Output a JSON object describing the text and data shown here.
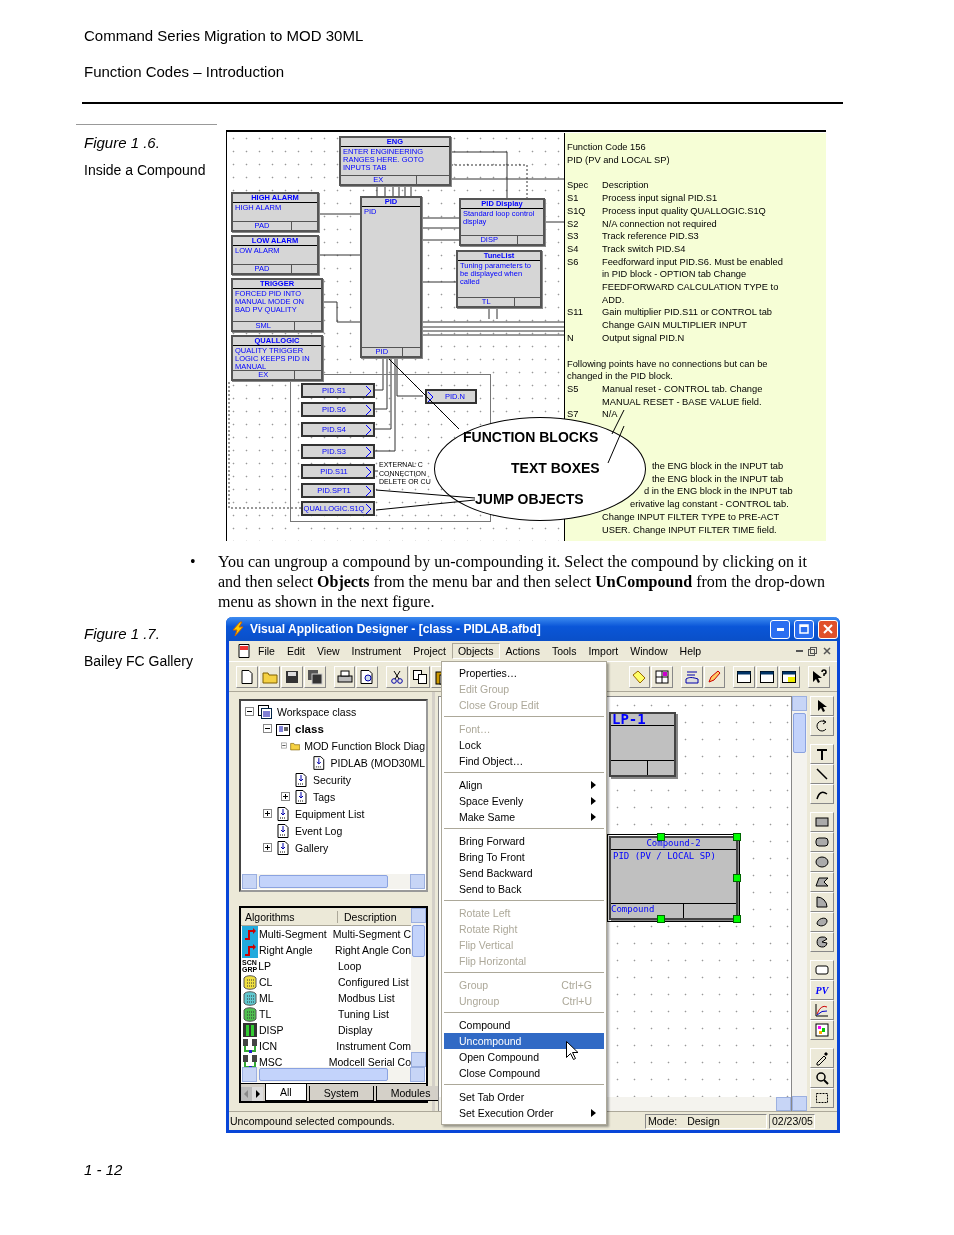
{
  "header": {
    "title": "Command Series Migration to MOD 30ML",
    "section": "Function Codes – Introduction"
  },
  "figure_1": {
    "number": "Figure 1 .6.",
    "caption": "Inside a Compound",
    "blocks": [
      {
        "title": "ENG",
        "text": "ENTER ENGINEERING RANGES HERE. GOTO INPUTS TAB",
        "footer": "EX"
      },
      {
        "title": "HIGH ALARM",
        "text": "HIGH ALARM",
        "footer": "PAD"
      },
      {
        "title": "LOW ALARM",
        "text": "LOW ALARM",
        "footer": "PAD"
      },
      {
        "title": "TRIGGER",
        "text": "FORCED PID INTO MANUAL MODE ON BAD PV QUALITY",
        "footer": "SML"
      },
      {
        "title": "QUALLOGIC",
        "text": "QUALITY TRIGGER LOGIC KEEPS PID IN MANUAL",
        "footer": "EX"
      },
      {
        "title": "PID",
        "text": "PID",
        "footer": "PID"
      },
      {
        "title": "PID Display",
        "text": "Standard loop control display",
        "footer": "DISP"
      },
      {
        "title": "TuneList",
        "text": "Tuning parameters to be displayed when called",
        "footer": "TL"
      }
    ],
    "jumps": [
      "PID.S1",
      "PID.S6",
      "PID.S4",
      "PID.S3",
      "PID.S11",
      "PID.SPT1",
      "QUALLOGIC.S1Q"
    ],
    "output_jump": "PID.N",
    "note": [
      "EXTERNAL C",
      "CONNECTION",
      "DELETE OR CU"
    ],
    "callout": [
      "FUNCTION BLOCKS",
      "TEXT BOXES",
      "JUMP OBJECTS"
    ],
    "panel": {
      "heading": [
        "Function Code 156",
        "PID (PV and LOCAL SP)"
      ],
      "columns": [
        "Spec",
        "Description"
      ],
      "rows": [
        {
          "spec": "S1",
          "desc": "Process input signal PID.S1"
        },
        {
          "spec": "S1Q",
          "desc": "Process input quality QUALLOGIC.S1Q"
        },
        {
          "spec": "S2",
          "desc": "N/A connection not required"
        },
        {
          "spec": "S3",
          "desc": "Track reference PID.S3"
        },
        {
          "spec": "S4",
          "desc": "Track switch PID.S4"
        },
        {
          "spec": "S6",
          "desc": "Feedforward input PID.S6. Must be enabled in PID block - OPTION tab Change FEEDFORWARD CALCULATION TYPE to ADD."
        },
        {
          "spec": "S11",
          "desc": "Gain multiplier PID.S11 or CONTROL tab Change GAIN MULTIPLIER INPUT"
        },
        {
          "spec": "N",
          "desc": "Output signal PID.N"
        }
      ],
      "note": "Following points have no connections but can be changed in the PID block.",
      "rows_2": [
        {
          "spec": "S5",
          "desc": "Manual reset - CONTROL tab. Change MANUAL RESET - BASE VALUE field."
        },
        {
          "spec": "S7",
          "desc": "N/A"
        }
      ],
      "fragments": [
        "the ENG block in the INPUT tab",
        "the ENG block in the INPUT tab",
        "d in the ENG block in the INPUT tab",
        "erivative lag constant - CONTROL tab.",
        "Change INPUT FILTER TYPE to PRE-ACT",
        "USER. Change INPUT FILTER TIME field."
      ]
    }
  },
  "bullet": {
    "mark": "•",
    "text": "You can ungroup a compound by un-compounding it. Select the compound by clicking on it and then select **Objects** from the menu bar and then select **UnCompound** from the drop-down menu as shown in the next figure."
  },
  "figure_2": {
    "number": "Figure 1 .7.",
    "caption": "Bailey FC Gallery",
    "window": {
      "title": "Visual Application Designer - [class - PIDLAB.afbd]",
      "menu": [
        {
          "label": "File",
          "selected": false
        },
        {
          "label": "Edit",
          "selected": false
        },
        {
          "label": "View",
          "selected": false
        },
        {
          "label": "Instrument",
          "selected": false
        },
        {
          "label": "Project",
          "selected": false
        },
        {
          "label": "Objects",
          "selected": true
        },
        {
          "label": "Actions",
          "selected": false
        },
        {
          "label": "Tools",
          "selected": false
        },
        {
          "label": "Import",
          "selected": false
        },
        {
          "label": "Window",
          "selected": false
        },
        {
          "label": "Help",
          "selected": false
        }
      ],
      "tree": [
        {
          "label": "Workspace class",
          "kind": "workspace",
          "expanded": true,
          "active": false,
          "children": [
            {
              "label": "class",
              "kind": "project",
              "expanded": true,
              "active": true,
              "children": [
                {
                  "label": "MOD Function Block Diag",
                  "kind": "folder",
                  "expanded": true,
                  "active": false,
                  "children": [
                    {
                      "label": "PIDLAB (MOD30ML",
                      "kind": "document",
                      "active": false
                    }
                  ]
                },
                {
                  "label": "Security",
                  "kind": "document",
                  "active": false
                },
                {
                  "label": "Tags",
                  "kind": "document",
                  "expanded": false,
                  "active": false
                }
              ]
            },
            {
              "label": "Equipment List",
              "kind": "document",
              "expanded": false,
              "active": false
            },
            {
              "label": "Event Log",
              "kind": "document",
              "active": false
            },
            {
              "label": "Gallery",
              "kind": "document",
              "expanded": false,
              "active": false
            }
          ]
        }
      ],
      "algorithms": {
        "columns": [
          "Algorithms",
          "Description"
        ],
        "rows": [
          {
            "name": "Multi-Segment",
            "desc": "Multi-Segment C",
            "kind": "connector"
          },
          {
            "name": "Right Angle",
            "desc": "Right Angle Con",
            "kind": "connector"
          },
          {
            "name": "LP",
            "desc": "Loop",
            "kind": "group",
            "badge": [
              "SCN",
              "GRP"
            ]
          },
          {
            "name": "CL",
            "desc": "Configured List",
            "kind": "list",
            "color": "#f0e040"
          },
          {
            "name": "ML",
            "desc": "Modbus List",
            "kind": "list",
            "color": "#60c8d0"
          },
          {
            "name": "TL",
            "desc": "Tuning List",
            "kind": "list",
            "color": "#50c050"
          },
          {
            "name": "DISP",
            "desc": "Display",
            "kind": "display"
          },
          {
            "name": "ICN",
            "desc": "Instrument Com",
            "kind": "network"
          },
          {
            "name": "MSC",
            "desc": "Modcell Serial Co",
            "kind": "network"
          }
        ],
        "tabs": [
          {
            "label": "All",
            "selected": true
          },
          {
            "label": "System",
            "selected": false
          },
          {
            "label": "Modules",
            "selected": false
          }
        ]
      },
      "canvas_blocks": [
        {
          "title": "LP-1",
          "selected": false
        },
        {
          "title": "Compound-2",
          "text": "PID (PV / LOCAL SP)",
          "footer": "Compound",
          "selected": true
        }
      ],
      "palette_label": "PV",
      "objects_menu": [
        {
          "label": "Properties…",
          "disabled": false,
          "selected": false
        },
        {
          "label": "Edit Group",
          "disabled": true,
          "selected": false
        },
        {
          "label": "Close Group Edit",
          "disabled": true,
          "selected": false
        },
        {
          "kind": "separator"
        },
        {
          "label": "Font…",
          "disabled": true,
          "selected": false
        },
        {
          "label": "Lock",
          "disabled": false,
          "selected": false
        },
        {
          "label": "Find Object…",
          "disabled": false,
          "selected": false
        },
        {
          "kind": "separator"
        },
        {
          "label": "Align",
          "disabled": false,
          "selected": false,
          "submenu": true
        },
        {
          "label": "Space Evenly",
          "disabled": false,
          "selected": false,
          "submenu": true
        },
        {
          "label": "Make Same",
          "disabled": false,
          "selected": false,
          "submenu": true
        },
        {
          "kind": "separator"
        },
        {
          "label": "Bring Forward",
          "disabled": false,
          "selected": false
        },
        {
          "label": "Bring To Front",
          "disabled": false,
          "selected": false
        },
        {
          "label": "Send Backward",
          "disabled": false,
          "selected": false
        },
        {
          "label": "Send to Back",
          "disabled": false,
          "selected": false
        },
        {
          "kind": "separator"
        },
        {
          "label": "Rotate Left",
          "disabled": true,
          "selected": false
        },
        {
          "label": "Rotate Right",
          "disabled": true,
          "selected": false
        },
        {
          "label": "Flip Vertical",
          "disabled": true,
          "selected": false
        },
        {
          "label": "Flip Horizontal",
          "disabled": true,
          "selected": false
        },
        {
          "kind": "separator"
        },
        {
          "label": "Group",
          "shortcut": "Ctrl+G",
          "disabled": true,
          "selected": false
        },
        {
          "label": "Ungroup",
          "shortcut": "Ctrl+U",
          "disabled": true,
          "selected": false
        },
        {
          "kind": "separator"
        },
        {
          "label": "Compound",
          "disabled": false,
          "selected": false
        },
        {
          "label": "Uncompound",
          "disabled": false,
          "selected": true
        },
        {
          "label": "Open Compound",
          "disabled": false,
          "selected": false
        },
        {
          "label": "Close Compound",
          "disabled": false,
          "selected": false
        },
        {
          "kind": "separator"
        },
        {
          "label": "Set Tab Order",
          "disabled": false,
          "selected": false
        },
        {
          "label": "Set Execution Order",
          "disabled": false,
          "selected": false,
          "submenu": true
        }
      ],
      "status": {
        "message": "Uncompound selected compounds.",
        "mode_label": "Mode:",
        "mode": "Design",
        "date": "02/23/05"
      }
    }
  },
  "footer": {
    "page": "1 - 12"
  }
}
